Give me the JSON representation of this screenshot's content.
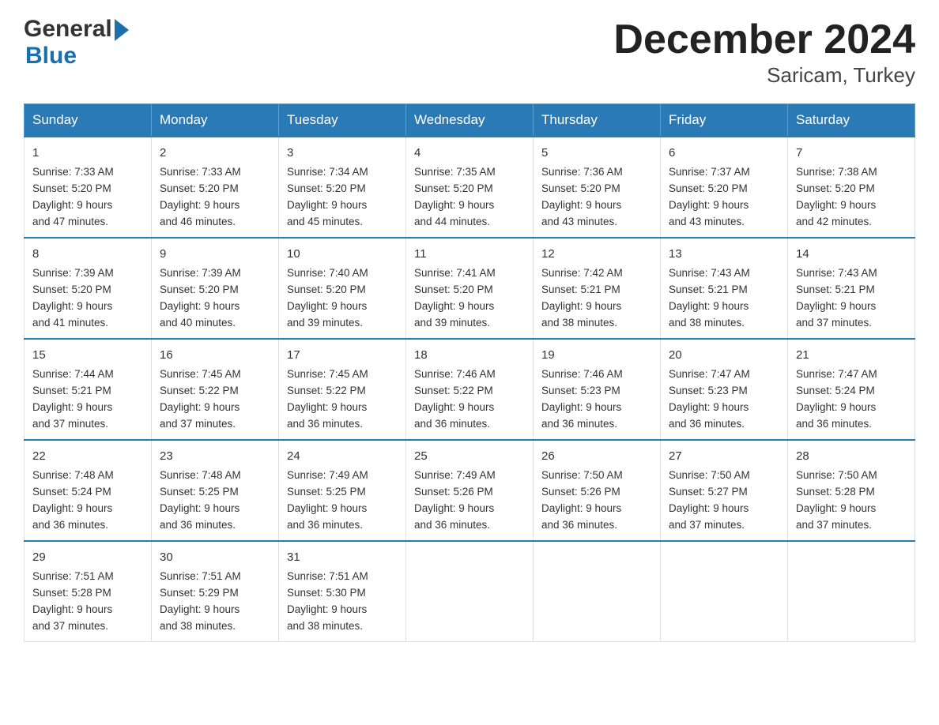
{
  "header": {
    "logo_general": "General",
    "logo_blue": "Blue",
    "title": "December 2024",
    "subtitle": "Saricam, Turkey"
  },
  "days_of_week": [
    "Sunday",
    "Monday",
    "Tuesday",
    "Wednesday",
    "Thursday",
    "Friday",
    "Saturday"
  ],
  "weeks": [
    [
      {
        "day": "1",
        "sunrise": "7:33 AM",
        "sunset": "5:20 PM",
        "daylight": "9 hours and 47 minutes."
      },
      {
        "day": "2",
        "sunrise": "7:33 AM",
        "sunset": "5:20 PM",
        "daylight": "9 hours and 46 minutes."
      },
      {
        "day": "3",
        "sunrise": "7:34 AM",
        "sunset": "5:20 PM",
        "daylight": "9 hours and 45 minutes."
      },
      {
        "day": "4",
        "sunrise": "7:35 AM",
        "sunset": "5:20 PM",
        "daylight": "9 hours and 44 minutes."
      },
      {
        "day": "5",
        "sunrise": "7:36 AM",
        "sunset": "5:20 PM",
        "daylight": "9 hours and 43 minutes."
      },
      {
        "day": "6",
        "sunrise": "7:37 AM",
        "sunset": "5:20 PM",
        "daylight": "9 hours and 43 minutes."
      },
      {
        "day": "7",
        "sunrise": "7:38 AM",
        "sunset": "5:20 PM",
        "daylight": "9 hours and 42 minutes."
      }
    ],
    [
      {
        "day": "8",
        "sunrise": "7:39 AM",
        "sunset": "5:20 PM",
        "daylight": "9 hours and 41 minutes."
      },
      {
        "day": "9",
        "sunrise": "7:39 AM",
        "sunset": "5:20 PM",
        "daylight": "9 hours and 40 minutes."
      },
      {
        "day": "10",
        "sunrise": "7:40 AM",
        "sunset": "5:20 PM",
        "daylight": "9 hours and 39 minutes."
      },
      {
        "day": "11",
        "sunrise": "7:41 AM",
        "sunset": "5:20 PM",
        "daylight": "9 hours and 39 minutes."
      },
      {
        "day": "12",
        "sunrise": "7:42 AM",
        "sunset": "5:21 PM",
        "daylight": "9 hours and 38 minutes."
      },
      {
        "day": "13",
        "sunrise": "7:43 AM",
        "sunset": "5:21 PM",
        "daylight": "9 hours and 38 minutes."
      },
      {
        "day": "14",
        "sunrise": "7:43 AM",
        "sunset": "5:21 PM",
        "daylight": "9 hours and 37 minutes."
      }
    ],
    [
      {
        "day": "15",
        "sunrise": "7:44 AM",
        "sunset": "5:21 PM",
        "daylight": "9 hours and 37 minutes."
      },
      {
        "day": "16",
        "sunrise": "7:45 AM",
        "sunset": "5:22 PM",
        "daylight": "9 hours and 37 minutes."
      },
      {
        "day": "17",
        "sunrise": "7:45 AM",
        "sunset": "5:22 PM",
        "daylight": "9 hours and 36 minutes."
      },
      {
        "day": "18",
        "sunrise": "7:46 AM",
        "sunset": "5:22 PM",
        "daylight": "9 hours and 36 minutes."
      },
      {
        "day": "19",
        "sunrise": "7:46 AM",
        "sunset": "5:23 PM",
        "daylight": "9 hours and 36 minutes."
      },
      {
        "day": "20",
        "sunrise": "7:47 AM",
        "sunset": "5:23 PM",
        "daylight": "9 hours and 36 minutes."
      },
      {
        "day": "21",
        "sunrise": "7:47 AM",
        "sunset": "5:24 PM",
        "daylight": "9 hours and 36 minutes."
      }
    ],
    [
      {
        "day": "22",
        "sunrise": "7:48 AM",
        "sunset": "5:24 PM",
        "daylight": "9 hours and 36 minutes."
      },
      {
        "day": "23",
        "sunrise": "7:48 AM",
        "sunset": "5:25 PM",
        "daylight": "9 hours and 36 minutes."
      },
      {
        "day": "24",
        "sunrise": "7:49 AM",
        "sunset": "5:25 PM",
        "daylight": "9 hours and 36 minutes."
      },
      {
        "day": "25",
        "sunrise": "7:49 AM",
        "sunset": "5:26 PM",
        "daylight": "9 hours and 36 minutes."
      },
      {
        "day": "26",
        "sunrise": "7:50 AM",
        "sunset": "5:26 PM",
        "daylight": "9 hours and 36 minutes."
      },
      {
        "day": "27",
        "sunrise": "7:50 AM",
        "sunset": "5:27 PM",
        "daylight": "9 hours and 37 minutes."
      },
      {
        "day": "28",
        "sunrise": "7:50 AM",
        "sunset": "5:28 PM",
        "daylight": "9 hours and 37 minutes."
      }
    ],
    [
      {
        "day": "29",
        "sunrise": "7:51 AM",
        "sunset": "5:28 PM",
        "daylight": "9 hours and 37 minutes."
      },
      {
        "day": "30",
        "sunrise": "7:51 AM",
        "sunset": "5:29 PM",
        "daylight": "9 hours and 38 minutes."
      },
      {
        "day": "31",
        "sunrise": "7:51 AM",
        "sunset": "5:30 PM",
        "daylight": "9 hours and 38 minutes."
      },
      null,
      null,
      null,
      null
    ]
  ],
  "labels": {
    "sunrise": "Sunrise:",
    "sunset": "Sunset:",
    "daylight": "Daylight:"
  }
}
